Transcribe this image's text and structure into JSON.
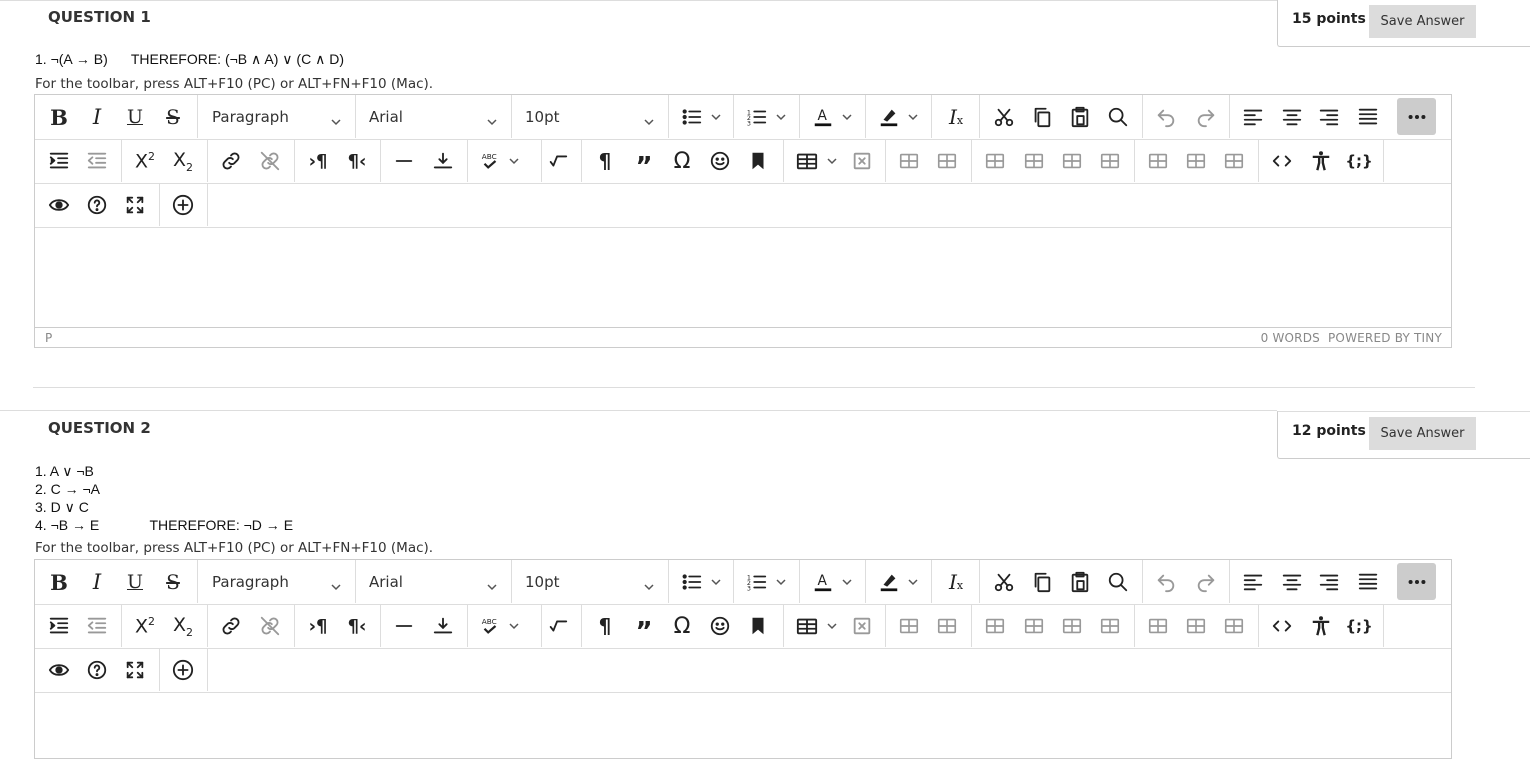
{
  "questions": [
    {
      "title": "QUESTION 1",
      "points": "15 points",
      "save_label": "Save Answer",
      "lines": [
        "1. ¬(A → B)      THEREFORE: (¬B ∧ A) ∨ (C ∧ D)"
      ],
      "toolbar_hint": "For the toolbar, press ALT+F10 (PC) or ALT+FN+F10 (Mac).",
      "editor": {
        "block_format": "Paragraph",
        "font_family": "Arial",
        "font_size": "10pt",
        "status_path": "P",
        "word_count": "0 WORDS",
        "powered_by": "POWERED BY TINY"
      }
    },
    {
      "title": "QUESTION 2",
      "points": "12 points",
      "save_label": "Save Answer",
      "lines": [
        "1. A ∨ ¬B",
        "2. C → ¬A",
        "3. D ∨ C",
        "4. ¬B → E             THEREFORE: ¬D → E"
      ],
      "toolbar_hint": "For the toolbar, press ALT+F10 (PC) or ALT+FN+F10 (Mac).",
      "editor": {
        "block_format": "Paragraph",
        "font_family": "Arial",
        "font_size": "10pt"
      }
    }
  ],
  "icons": {
    "row1": [
      "bold-icon",
      "italic-icon",
      "underline-icon",
      "strikethrough-icon",
      "bullet-list-icon",
      "numbered-list-icon",
      "text-color-icon",
      "highlight-icon",
      "clear-format-icon",
      "cut-icon",
      "copy-icon",
      "paste-icon",
      "search-icon",
      "undo-icon",
      "redo-icon",
      "align-left-icon",
      "align-center-icon",
      "align-right-icon",
      "justify-icon",
      "more-icon"
    ],
    "row2": [
      "indent-icon",
      "outdent-icon",
      "superscript-icon",
      "subscript-icon",
      "link-icon",
      "unlink-icon",
      "ltr-icon",
      "rtl-icon",
      "horizontal-rule-icon",
      "insert-line-icon",
      "spellcheck-icon",
      "math-icon",
      "paragraph-mark-icon",
      "quote-icon",
      "omega-icon",
      "emoji-icon",
      "bookmark-icon",
      "table-icon",
      "delete-table-icon",
      "table-cell-icons",
      "code-icon",
      "accessibility-icon",
      "template-icon"
    ],
    "row3": [
      "preview-icon",
      "help-icon",
      "fullscreen-icon",
      "add-content-icon"
    ]
  },
  "colors": {
    "save_button_bg": "#dcdcdc",
    "more_button_bg": "#cccccc",
    "border": "#cccccc"
  }
}
